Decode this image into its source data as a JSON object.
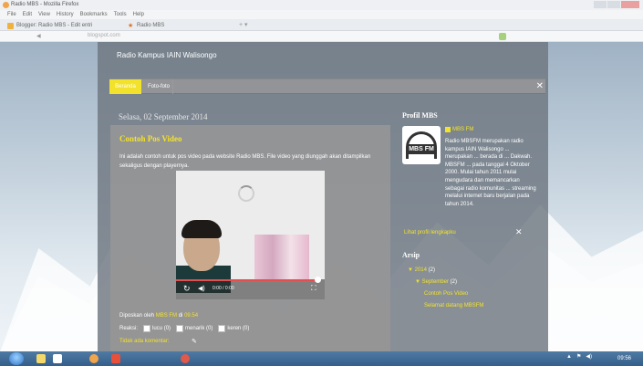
{
  "window": {
    "title": "Radio MBS - Mozilla Firefox"
  },
  "menu": [
    "File",
    "Edit",
    "View",
    "History",
    "Bookmarks",
    "Tools",
    "Help"
  ],
  "tabs": [
    {
      "label": "Blogger: Radio MBS - Edit entri"
    },
    {
      "label": "Radio MBS"
    }
  ],
  "nav": {
    "url": "blogspot.com"
  },
  "blog": {
    "title": "Radio Kampus IAIN Walisongo",
    "nav_items": [
      "Beranda",
      "Foto-foto"
    ],
    "date_header": "Selasa, 02 September 2014",
    "post": {
      "title": "Contoh Pos Video",
      "body": "Ini adalah contoh untuk pos video pada website Radio MBS. File video yang diunggah akan ditampilkan sekaligus dengan playernya.",
      "video_time": "0:00 / 0:00",
      "posted_prefix": "Diposkan oleh",
      "author": "MBS FM",
      "posted_at_prefix": "di",
      "posted_time": "09.54",
      "reactions_label": "Reaksi:",
      "reactions": [
        "lucu (0)",
        "menarik (0)",
        "keren (0)"
      ],
      "comments": "Tidak ada komentar:"
    },
    "sidebar": {
      "profile_title": "Profil MBS",
      "logo_text": "MBS FM",
      "profile_name": "MBS FM",
      "profile_desc": "Radio MBSFM merupakan radio kampus IAIN Walisongo ... merupakan ... berada di ... Dakwah. MBSFM ... pada tanggal 4 Oktober 2000. Mulai tahun 2011 mulai mengudara dan memancarkan sebagai radio komunitas ... streaming melalui internet baru berjalan pada tahun 2014.",
      "profile_link": "Lihat profil lengkapku",
      "archive_title": "Arsip",
      "archive": {
        "year": "2014",
        "year_count": "(2)",
        "month": "September",
        "month_count": "(2)",
        "posts": [
          "Contoh Pos Video",
          "Selamat datang MBSFM"
        ]
      }
    }
  },
  "taskbar": {
    "clock": "09:56"
  },
  "colors": {
    "accent": "#f3e22b",
    "panel": "#6e7680"
  }
}
